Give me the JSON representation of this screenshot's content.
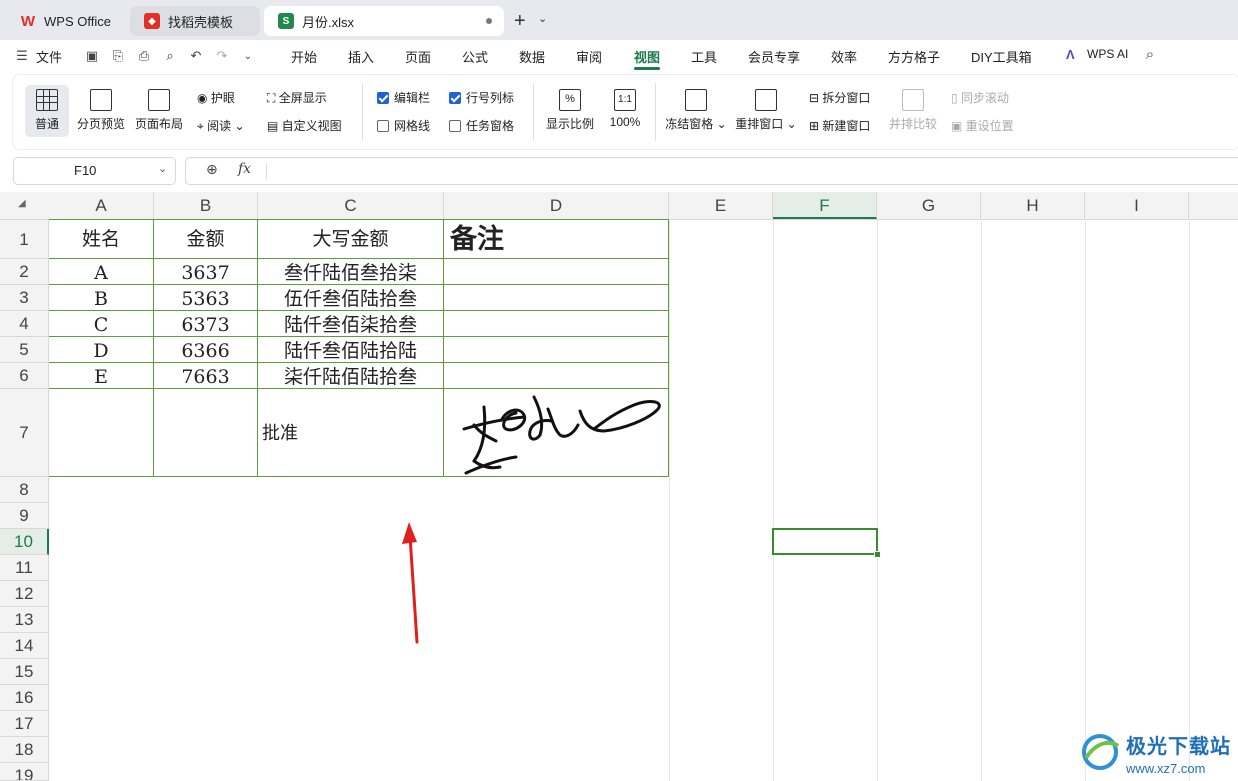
{
  "tabs": [
    {
      "label": "WPS Office"
    },
    {
      "label": "找稻壳模板"
    },
    {
      "label": "月份.xlsx"
    }
  ],
  "menu": {
    "file": "文件",
    "items": [
      "开始",
      "插入",
      "页面",
      "公式",
      "数据",
      "审阅",
      "视图",
      "工具",
      "会员专享",
      "效率",
      "方方格子",
      "DIY工具箱"
    ],
    "active": "视图",
    "wps_ai": "WPS AI"
  },
  "ribbon": {
    "normal": "普通",
    "page_break_preview": "分页预览",
    "page_layout": "页面布局",
    "eye_protect": "护眼",
    "reading": "阅读",
    "full_screen": "全屏显示",
    "custom_view": "自定义视图",
    "edit_bar": "编辑栏",
    "row_col_headers": "行号列标",
    "gridlines": "网格线",
    "task_pane": "任务窗格",
    "zoom": "显示比例",
    "zoom_100": "100%",
    "freeze": "冻结窗格",
    "arrange": "重排窗口",
    "split": "拆分窗口",
    "new_window": "新建窗口",
    "side_by_side": "并排比较",
    "sync_scroll": "同步滚动",
    "reset_position": "重设位置"
  },
  "namebox": "F10",
  "columns": [
    "A",
    "B",
    "C",
    "D",
    "E",
    "F",
    "G",
    "H",
    "I"
  ],
  "rows": [
    "1",
    "2",
    "3",
    "4",
    "5",
    "6",
    "7",
    "8",
    "9",
    "10",
    "11",
    "12",
    "13",
    "14",
    "15",
    "16",
    "17",
    "18",
    "19"
  ],
  "table": {
    "headers": [
      "姓名",
      "金额",
      "大写金额",
      "备注"
    ],
    "rows": [
      [
        "A",
        "3637",
        "叁仟陆佰叁拾柒",
        ""
      ],
      [
        "B",
        "5363",
        "伍仟叁佰陆拾叁",
        ""
      ],
      [
        "C",
        "6373",
        "陆仟叁佰柒拾叁",
        ""
      ],
      [
        "D",
        "6366",
        "陆仟叁佰陆拾陆",
        ""
      ],
      [
        "E",
        "7663",
        "柒仟陆佰陆拾叁",
        ""
      ]
    ],
    "approval_label": "批准"
  },
  "watermark": "极光下载站 www.xz7.com",
  "colors": {
    "accent": "#1e7a4c",
    "table_border": "#5f9b3f",
    "arrow": "#e0201c"
  }
}
